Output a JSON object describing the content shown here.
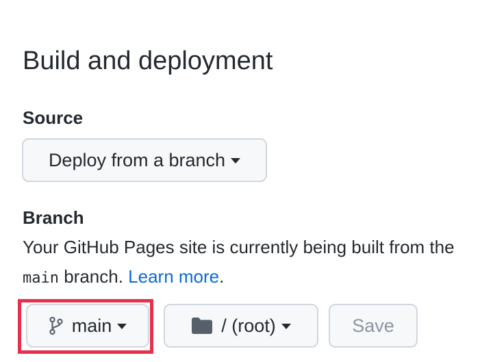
{
  "section": {
    "title": "Build and deployment"
  },
  "source": {
    "label": "Source",
    "dropdown_value": "Deploy from a branch"
  },
  "branch": {
    "label": "Branch",
    "description_prefix": "Your GitHub Pages site is currently being built from the ",
    "branch_code": "main",
    "description_suffix": " branch. ",
    "learn_more": "Learn more",
    "period": ".",
    "branch_selector": {
      "value": "main",
      "icon": "git-branch-icon"
    },
    "folder_selector": {
      "value": "/ (root)",
      "icon": "folder-icon"
    },
    "save_label": "Save"
  },
  "colors": {
    "link": "#0969da",
    "highlight": "#e8304d",
    "button_bg": "#f6f8fa",
    "button_border": "#d0d7de",
    "disabled_text": "#8c959f"
  }
}
